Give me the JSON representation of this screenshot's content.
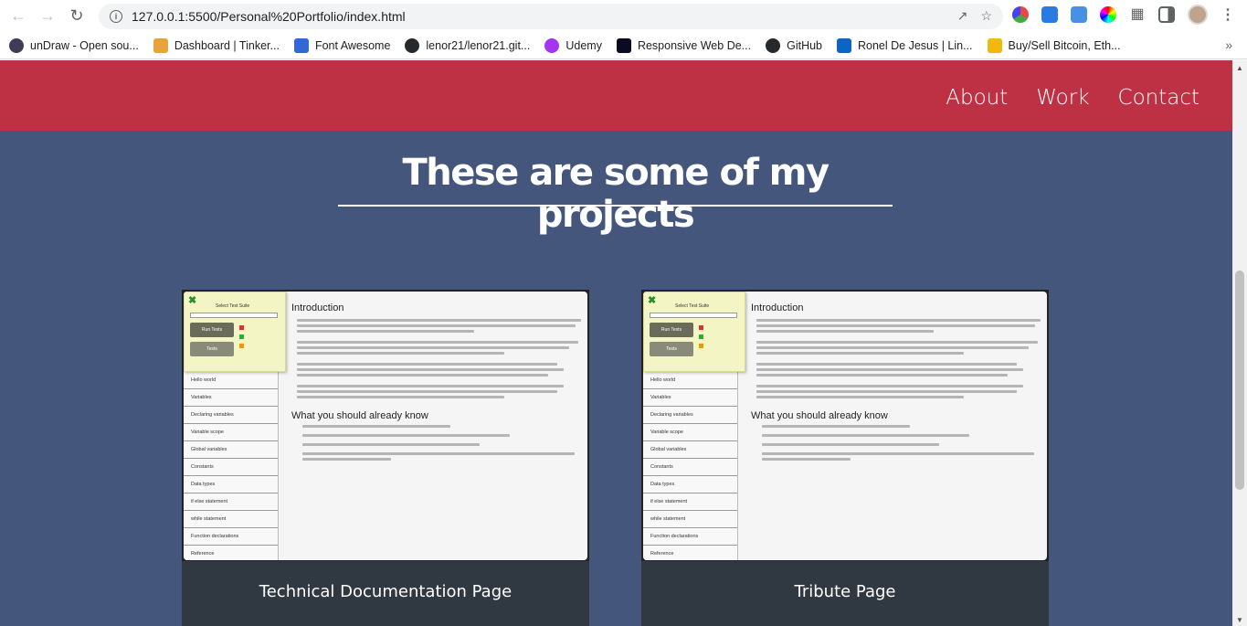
{
  "browser": {
    "url": "127.0.0.1:5500/Personal%20Portfolio/index.html",
    "bookmarks": [
      {
        "label": "unDraw - Open sou...",
        "color": "#3f3d56"
      },
      {
        "label": "Dashboard | Tinker...",
        "color": "#e8a33d"
      },
      {
        "label": "Font Awesome",
        "color": "#3367d6"
      },
      {
        "label": "lenor21/lenor21.git...",
        "color": "#24292e"
      },
      {
        "label": "Udemy",
        "color": "#a435f0"
      },
      {
        "label": "Responsive Web De...",
        "color": "#0a0a23"
      },
      {
        "label": "GitHub",
        "color": "#24292e"
      },
      {
        "label": "Ronel De Jesus | Lin...",
        "color": "#0a66c2"
      },
      {
        "label": "Buy/Sell Bitcoin, Eth...",
        "color": "#f0b90b"
      }
    ]
  },
  "nav": {
    "about": "About",
    "work": "Work",
    "contact": "Contact"
  },
  "section": {
    "title": "These are some of my projects"
  },
  "projects": [
    {
      "caption": "Technical Documentation Page"
    },
    {
      "caption": "Tribute Page"
    }
  ],
  "preview": {
    "heading": "Introduction",
    "heading2": "What you should already know",
    "panel_title": "Select Test Suite",
    "run_label": "Run Tests",
    "tests_label": "Tests",
    "sidebar": [
      "Hello world",
      "Variables",
      "Declaring variables",
      "Variable scope",
      "Global variables",
      "Constants",
      "Data types",
      "if else statement",
      "while statement",
      "Function declarations",
      "Reference"
    ]
  },
  "colors": {
    "nav_bg": "#be3144",
    "page_bg": "#45567d",
    "card_bg": "#303841"
  }
}
